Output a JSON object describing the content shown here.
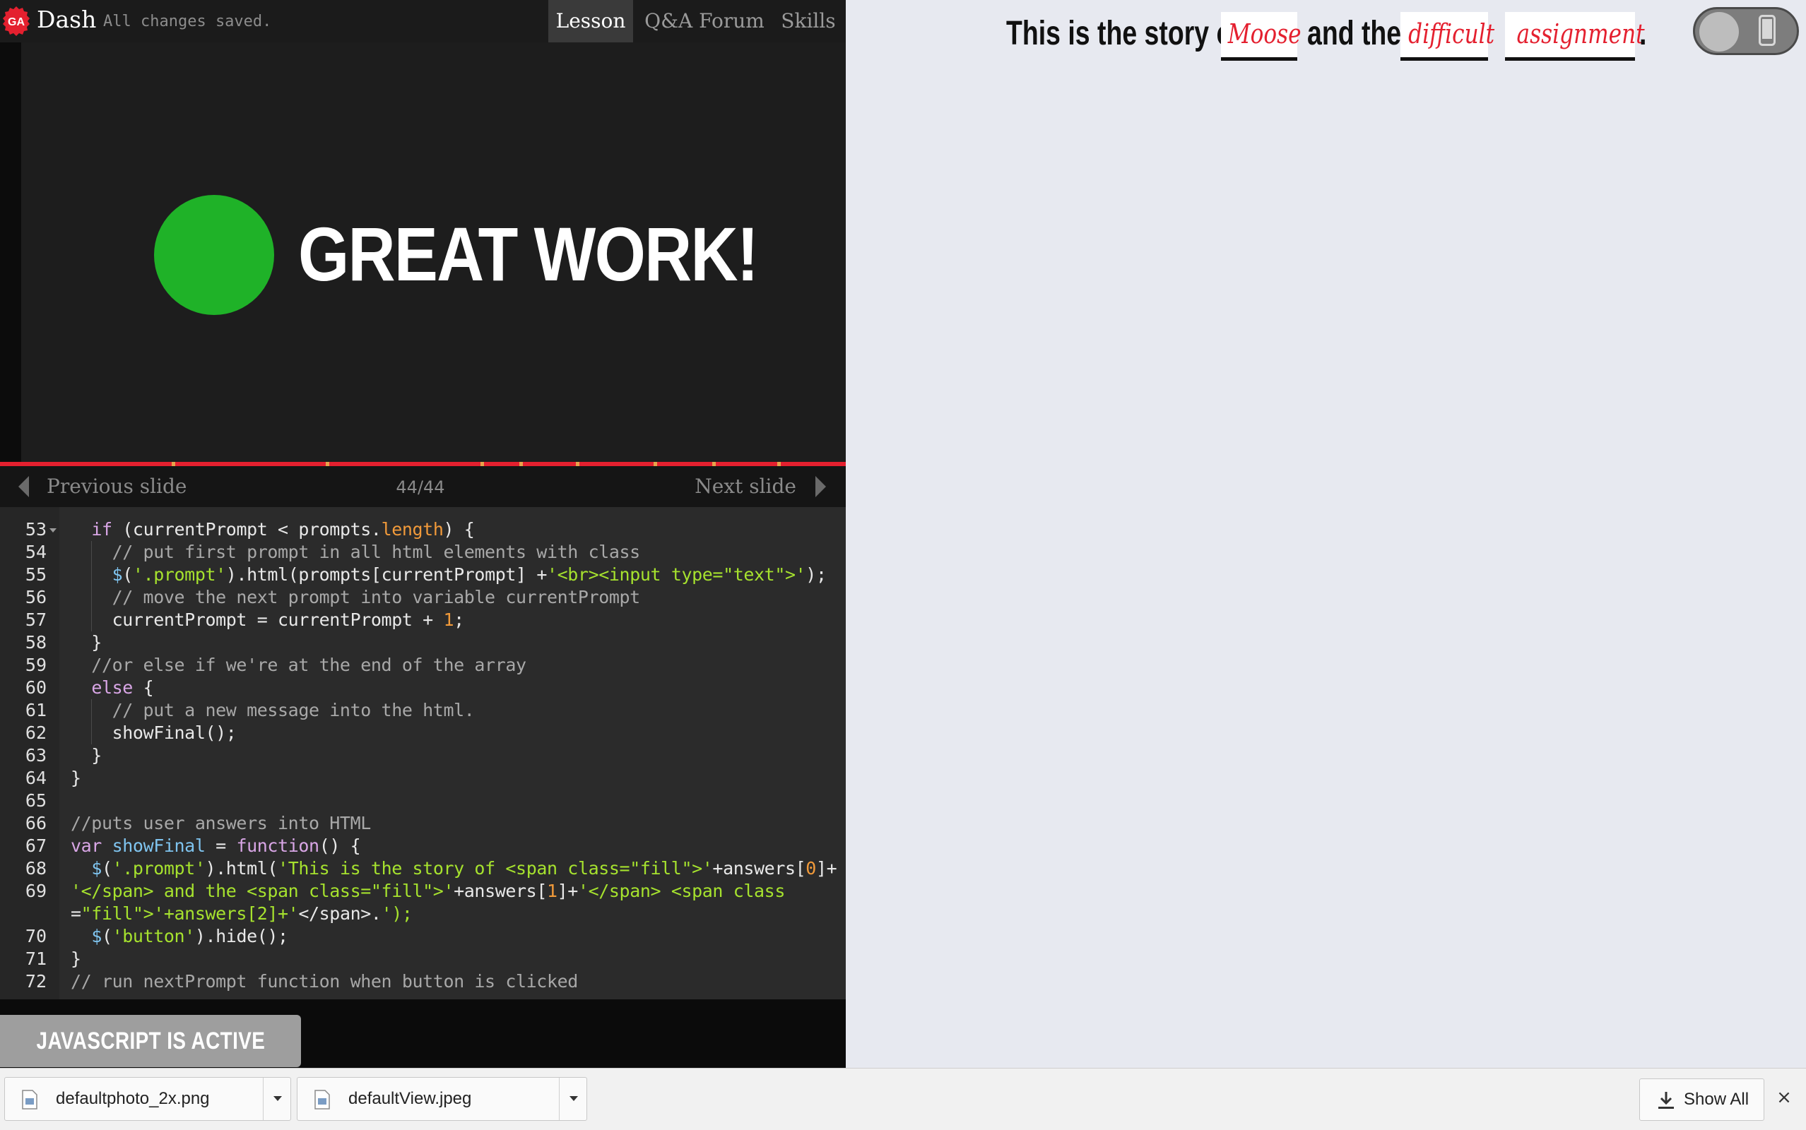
{
  "app": {
    "logo": "GA",
    "name": "Dash",
    "status": "All changes saved."
  },
  "nav": {
    "tabs": [
      {
        "label": "Lesson",
        "active": true
      },
      {
        "label": "Q&A Forum"
      },
      {
        "label": "Skills"
      }
    ]
  },
  "slide": {
    "headline": "GREAT WORK!",
    "circle_color": "#1fb228",
    "progress_percent": 100
  },
  "slide_nav": {
    "prev_label": "Previous slide",
    "counter": "44/44",
    "next_label": "Next slide"
  },
  "code": {
    "lines": [
      {
        "n": "53",
        "fold": true
      },
      {
        "n": "54"
      },
      {
        "n": "55"
      },
      {
        "n": "56"
      },
      {
        "n": "57"
      },
      {
        "n": "58"
      },
      {
        "n": "59"
      },
      {
        "n": "60"
      },
      {
        "n": "61"
      },
      {
        "n": "62"
      },
      {
        "n": "63"
      },
      {
        "n": "64"
      },
      {
        "n": "65"
      },
      {
        "n": "66"
      },
      {
        "n": "67"
      },
      {
        "n": "68"
      },
      {
        "n": "69"
      },
      {
        "n": ""
      },
      {
        "n": "70"
      },
      {
        "n": "71"
      },
      {
        "n": "72"
      }
    ],
    "text": [
      "  if (currentPrompt < prompts.length) {",
      "    // put first prompt in all html elements with class",
      "    $('.prompt').html(prompts[currentPrompt] +'<br><input type=\"text\">');",
      "    // move the next prompt into variable currentPrompt",
      "    currentPrompt = currentPrompt + 1;",
      "  }",
      "  //or else if we're at the end of the array",
      "  else {",
      "    // put a new message into the html.",
      "    showFinal();",
      "  }",
      "}",
      "",
      "//puts user answers into HTML",
      "var showFinal = function() {",
      "  $('.prompt').html('This is the story of <span class=\"fill\">'+answers[0]+",
      "'</span> and the <span class=\"fill\">'+answers[1]+'</span> <span class",
      "=\"fill\">'+answers[2]+'</span>.');",
      "  $('button').hide();",
      "}",
      "// run nextPrompt function when button is clicked"
    ]
  },
  "js_status": "JAVASCRIPT IS ACTIVE",
  "story": {
    "part1": "This is the story of",
    "answer1": "Moose",
    "part2": "and the",
    "answer2": "difficult",
    "answer3": "assignment",
    "period": ".",
    "answer_color": "#e4202f"
  },
  "toggle": {
    "icon": "phone-icon",
    "state": "off"
  },
  "downloads": {
    "items": [
      {
        "name": "defaultphoto_2x.png"
      },
      {
        "name": "defaultView.jpeg"
      }
    ],
    "show_all": "Show All",
    "close": "×"
  }
}
